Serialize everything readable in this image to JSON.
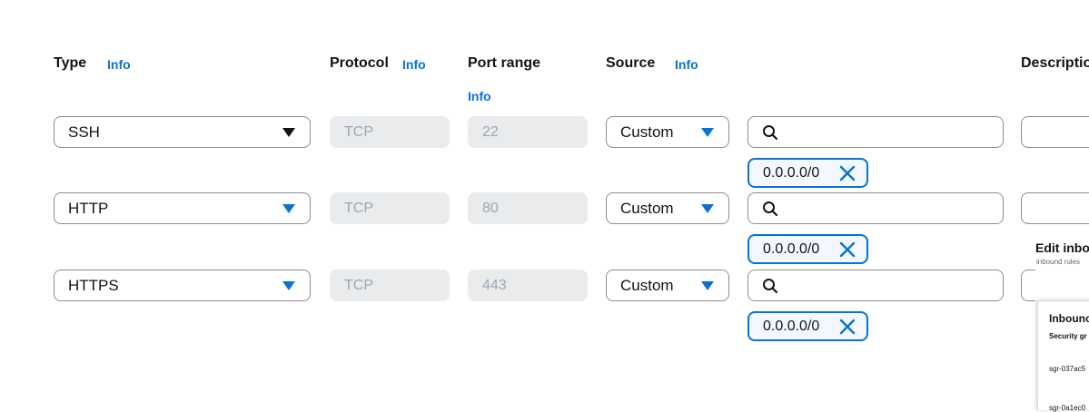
{
  "headers": {
    "type": "Type",
    "type_info": "Info",
    "protocol": "Protocol",
    "protocol_info": "Info",
    "port_range": "Port range",
    "port_range_info": "Info",
    "source": "Source",
    "source_info": "Info",
    "description": "Descriptio"
  },
  "rules": [
    {
      "type": "SSH",
      "protocol": "TCP",
      "port": "22",
      "source_type": "Custom",
      "source_token": "0.0.0.0/0"
    },
    {
      "type": "HTTP",
      "protocol": "TCP",
      "port": "80",
      "source_type": "Custom",
      "source_token": "0.0.0.0/0"
    },
    {
      "type": "HTTPS",
      "protocol": "TCP",
      "port": "443",
      "source_type": "Custom",
      "source_token": "0.0.0.0/0"
    }
  ],
  "preview": {
    "title": "Edit inbo",
    "subtitle": "inbound rules",
    "panel_title": "Inbounc",
    "panel_sub": "Security gr",
    "row1": "sgr-037ac5",
    "row2": "sgr-0a1ec0"
  },
  "colors": {
    "accent": "#0972d3",
    "disabled_bg": "#e9ebed",
    "border": "#8c8c94"
  },
  "icons": {
    "dropdown": "caret-down-icon",
    "search": "search-icon",
    "remove": "close-icon"
  }
}
